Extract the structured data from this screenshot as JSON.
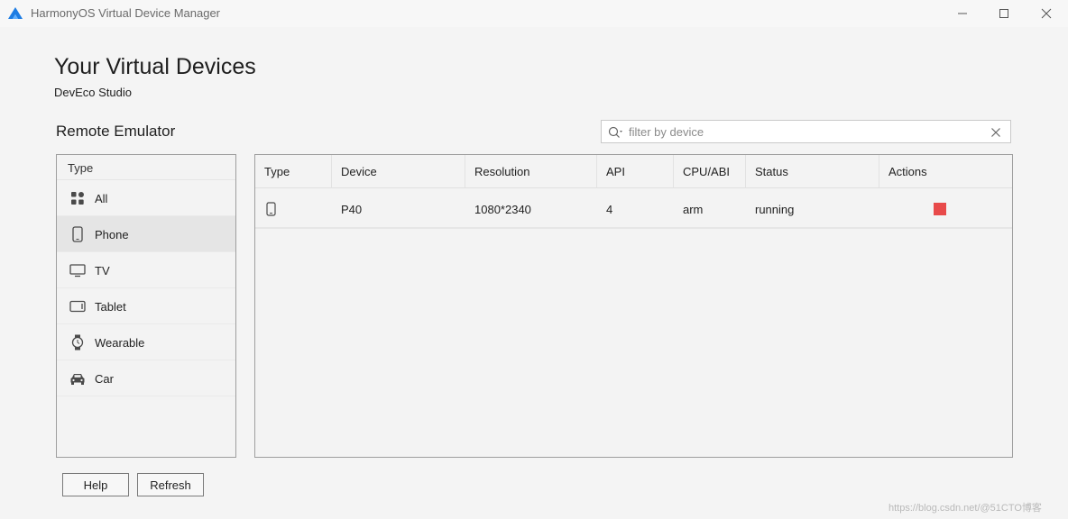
{
  "window": {
    "title": "HarmonyOS Virtual Device Manager"
  },
  "header": {
    "title": "Your Virtual Devices",
    "subtitle": "DevEco Studio"
  },
  "section_title": "Remote Emulator",
  "search": {
    "placeholder": "filter by device",
    "value": ""
  },
  "type_panel": {
    "header": "Type",
    "items": [
      {
        "label": "All",
        "icon": "grid-icon"
      },
      {
        "label": "Phone",
        "icon": "phone-icon",
        "selected": true
      },
      {
        "label": "TV",
        "icon": "tv-icon"
      },
      {
        "label": "Tablet",
        "icon": "tablet-icon"
      },
      {
        "label": "Wearable",
        "icon": "watch-icon"
      },
      {
        "label": "Car",
        "icon": "car-icon"
      }
    ]
  },
  "table": {
    "columns": [
      "Type",
      "Device",
      "Resolution",
      "API",
      "CPU/ABI",
      "Status",
      "Actions"
    ],
    "rows": [
      {
        "type_icon": "phone-icon",
        "device": "P40",
        "resolution": "1080*2340",
        "api": "4",
        "cpu": "arm",
        "status": "running",
        "action_icon": "stop-icon"
      }
    ]
  },
  "buttons": {
    "help": "Help",
    "refresh": "Refresh"
  },
  "watermark": "https://blog.csdn.net/@51CTO博客",
  "colors": {
    "stop": "#e84a4a",
    "logo": "#1c7ce3",
    "background": "#f4f4f4"
  }
}
